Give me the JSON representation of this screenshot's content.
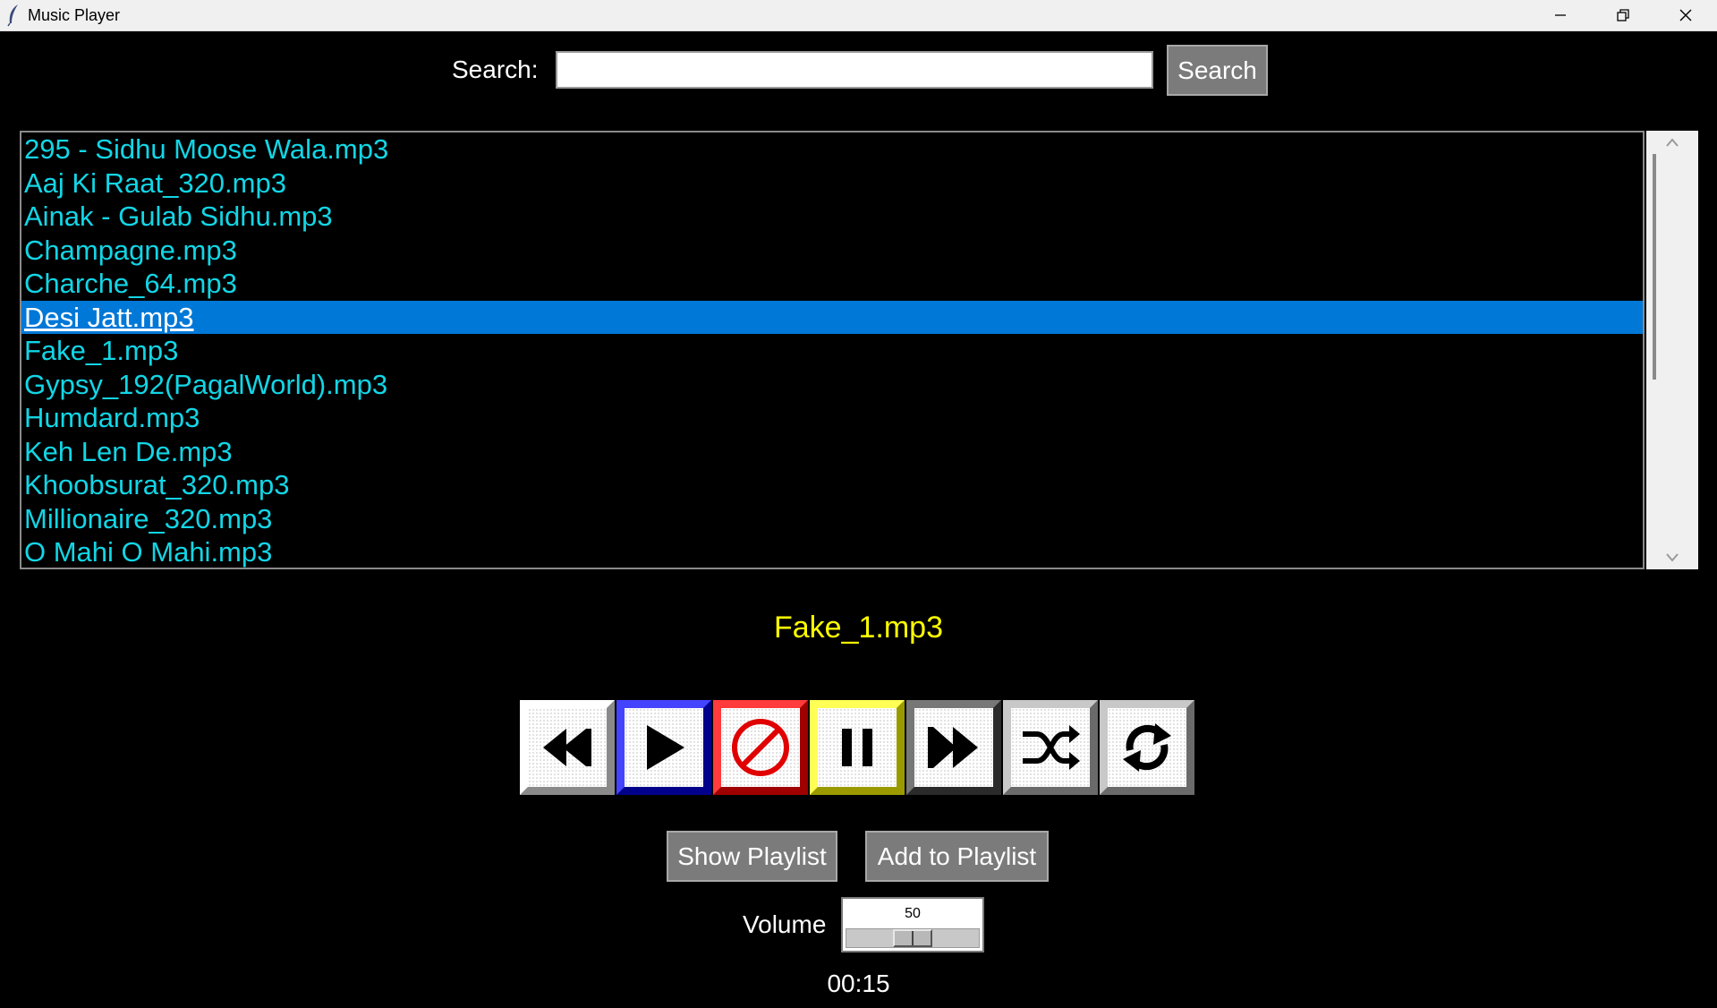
{
  "window": {
    "title": "Music Player"
  },
  "search": {
    "label": "Search:",
    "value": "",
    "placeholder": "",
    "button_label": "Search"
  },
  "songs": [
    "295 - Sidhu Moose Wala.mp3",
    "Aaj Ki Raat_320.mp3",
    "Ainak - Gulab Sidhu.mp3",
    "Champagne.mp3",
    "Charche_64.mp3",
    "Desi Jatt.mp3",
    "Fake_1.mp3",
    "Gypsy_192(PagalWorld).mp3",
    "Humdard.mp3",
    "Keh Len De.mp3",
    "Khoobsurat_320.mp3",
    "Millionaire_320.mp3",
    "O Mahi O Mahi.mp3"
  ],
  "selected_index": 5,
  "now_playing": "Fake_1.mp3",
  "controls": [
    {
      "name": "previous-button",
      "icon": "rewind-icon",
      "color": "#ffffff"
    },
    {
      "name": "play-button",
      "icon": "play-icon",
      "color": "#0000ff"
    },
    {
      "name": "stop-button",
      "icon": "stop-icon",
      "color": "#ff0000"
    },
    {
      "name": "pause-button",
      "icon": "pause-icon",
      "color": "#ffff00"
    },
    {
      "name": "next-button",
      "icon": "fast-forward-icon",
      "color": "#4a4a4a"
    },
    {
      "name": "shuffle-button",
      "icon": "shuffle-icon",
      "color": "#9a9a9a"
    },
    {
      "name": "repeat-button",
      "icon": "repeat-icon",
      "color": "#9a9a9a"
    }
  ],
  "playlist": {
    "show_label": "Show Playlist",
    "add_label": "Add to Playlist"
  },
  "volume": {
    "label": "Volume",
    "value": "50",
    "level_fraction": 0.5
  },
  "time": "00:15",
  "colors": {
    "song_text": "#12d6e6",
    "selection": "#0078d7",
    "now_playing": "#ffff00",
    "button_bg": "#7b7b7b"
  }
}
